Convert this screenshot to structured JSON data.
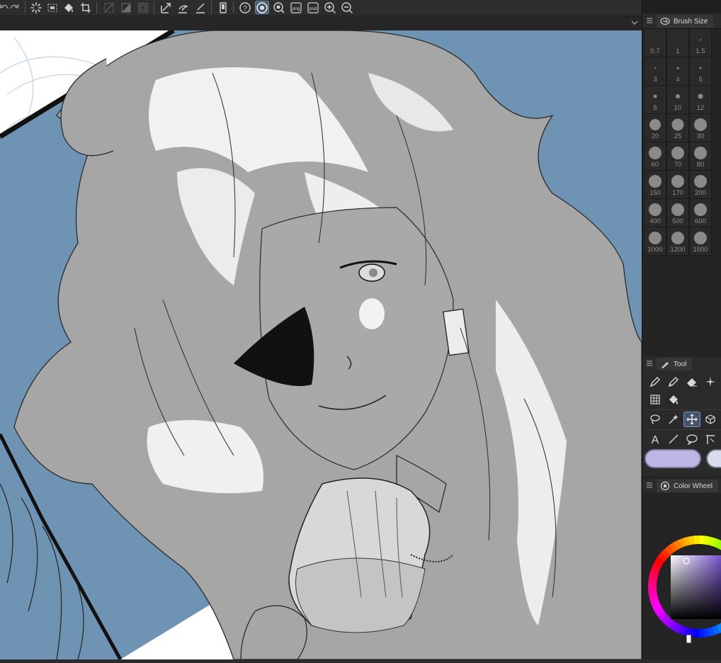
{
  "toolbar": {
    "icons": [
      "undo-icon",
      "redo-icon",
      "loading-icon",
      "select-all-icon",
      "fill-icon",
      "crop-icon",
      "deselect-icon",
      "invert-selection-icon",
      "selection-border-icon",
      "transform-icon",
      "fill-select-icon",
      "line-icon",
      "device-icon",
      "help-icon",
      "stabilizer-icon",
      "zoom-ring-icon",
      "png-icon",
      "psd-icon",
      "zoom-in-icon",
      "zoom-out-icon"
    ],
    "png_label": "png",
    "psd_label": "psd"
  },
  "brush_panel": {
    "title": "Brush Size",
    "sizes": [
      "0.7",
      "1",
      "1.5",
      "3",
      "4",
      "5",
      "8",
      "10",
      "12",
      "20",
      "25",
      "30",
      "60",
      "70",
      "80",
      "150",
      "170",
      "200",
      "400",
      "500",
      "600",
      "1000",
      "1200",
      "1500"
    ]
  },
  "tool_panel": {
    "title": "Tool",
    "tools_row1": [
      "pen-tool",
      "pencil-tool",
      "eraser-tool",
      "decoration-tool"
    ],
    "tools_row2": [
      "grid-tool",
      "fill-tool"
    ],
    "tools_row3": [
      "lasso-tool",
      "magic-wand-tool",
      "move-tool",
      "3d-tool"
    ],
    "tools_row4": [
      "text-tool",
      "line-tool",
      "speech-balloon-tool",
      "ruler-tool"
    ],
    "main_color": "#c0b6e6",
    "sub_color": "#d7dcee"
  },
  "color_panel": {
    "title": "Color Wheel",
    "hue_color": "#6b44c8"
  },
  "canvas": {
    "background_color": "#6f93b2",
    "figure_color": "#a6a6a6",
    "highlight_color": "#f3f3f3"
  }
}
